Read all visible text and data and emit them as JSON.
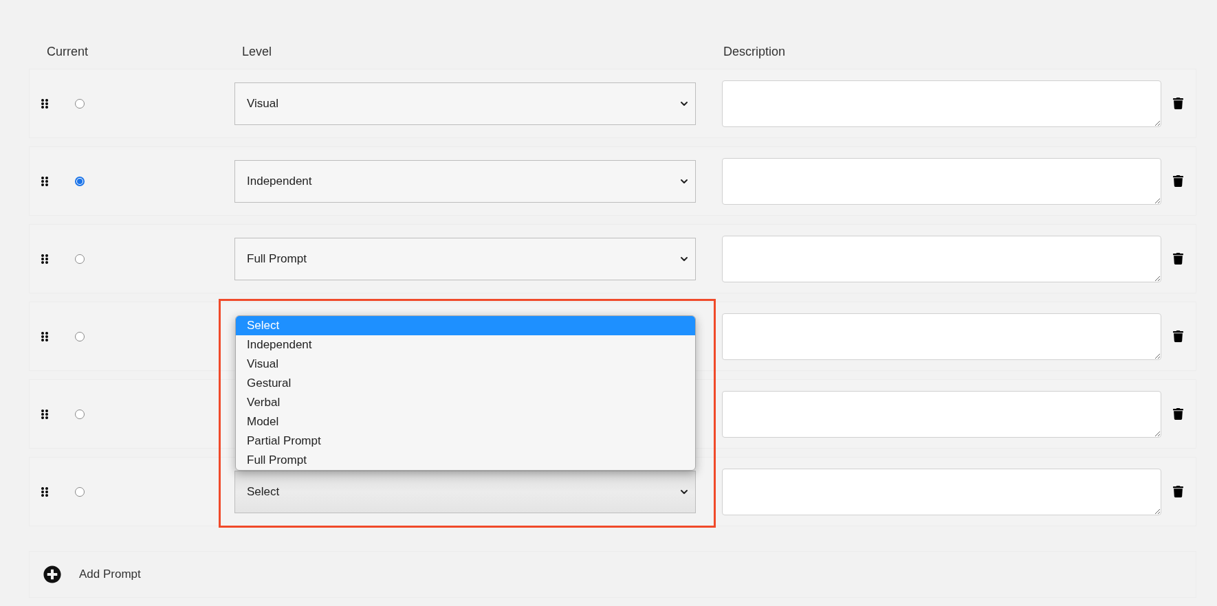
{
  "columns": [
    {
      "label": "Current"
    },
    {
      "label": "Level"
    },
    {
      "label": "Description"
    }
  ],
  "rows": [
    {
      "selected": false,
      "highlighted": false,
      "level": "Visual"
    },
    {
      "selected": true,
      "highlighted": false,
      "level": "Independent"
    },
    {
      "selected": false,
      "highlighted": false,
      "level": "Full Prompt"
    },
    {
      "selected": false,
      "highlighted": false
    },
    {
      "selected": false,
      "highlighted": false
    },
    {
      "selected": false,
      "highlighted": true,
      "level": "Select",
      "dropdown": {
        "options": [
          {
            "label": "Select",
            "selected": true
          },
          {
            "label": "Independent",
            "selected": false
          },
          {
            "label": "Visual",
            "selected": false
          },
          {
            "label": "Gestural",
            "selected": false
          },
          {
            "label": "Verbal",
            "selected": false
          },
          {
            "label": "Model",
            "selected": false
          },
          {
            "label": "Partial Prompt",
            "selected": false
          },
          {
            "label": "Full Prompt",
            "selected": false
          }
        ]
      }
    }
  ],
  "add_button": {
    "label": "Add Prompt"
  }
}
